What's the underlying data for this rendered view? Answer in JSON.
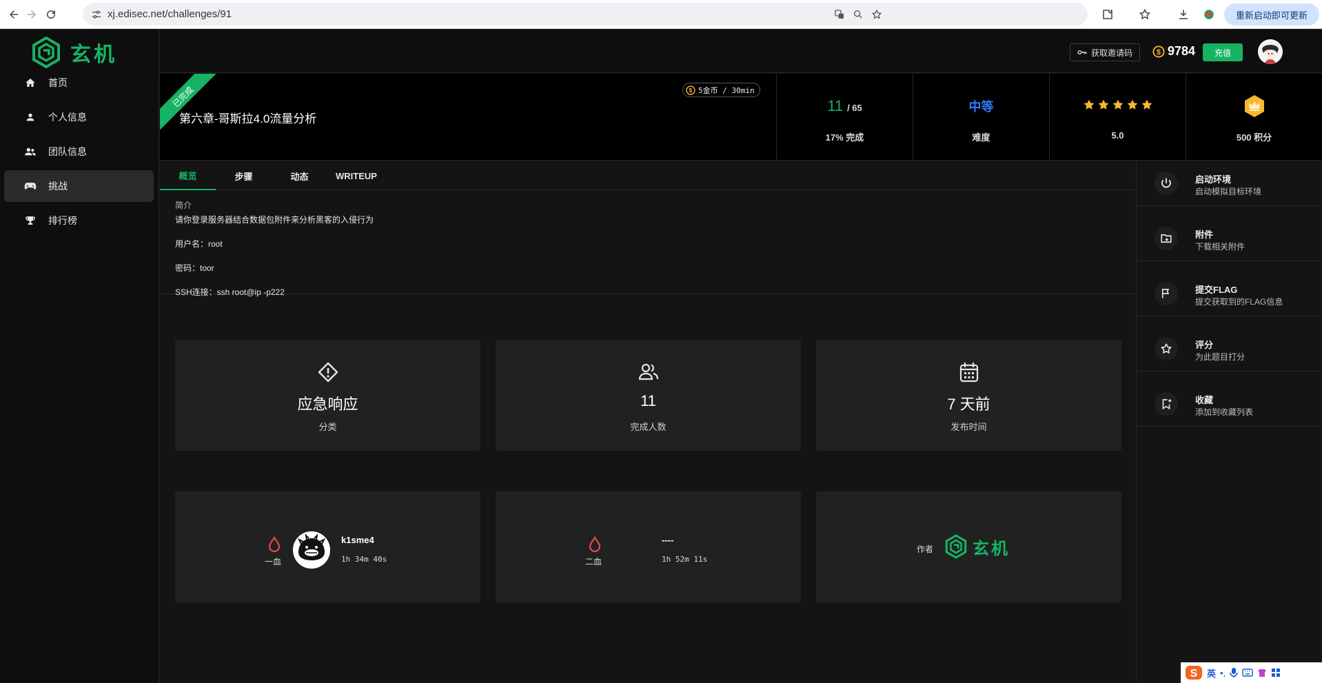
{
  "browser": {
    "url": "xj.edisec.net/challenges/91",
    "update_label": "重新启动即可更新"
  },
  "brand": {
    "name": "玄机",
    "color": "#16b364"
  },
  "sidebar": {
    "items": [
      {
        "label": "首页",
        "icon": "home-icon"
      },
      {
        "label": "个人信息",
        "icon": "person-icon"
      },
      {
        "label": "团队信息",
        "icon": "group-icon"
      },
      {
        "label": "挑战",
        "icon": "gamepad-icon",
        "active": true
      },
      {
        "label": "排行榜",
        "icon": "trophy-icon"
      }
    ]
  },
  "header": {
    "invite_label": "获取邀请码",
    "coins": "9784",
    "recharge_label": "充值"
  },
  "challenge": {
    "ribbon": "已完成",
    "title": "第六章-哥斯拉4.0流量分析",
    "cost": "5金币 / 30min",
    "completed": "11",
    "total": "/ 65",
    "completion_label": "17% 完成",
    "difficulty": "中等",
    "difficulty_label": "难度",
    "difficulty_color": "#2f7bf6",
    "rating": "5.0",
    "stars": 5,
    "points_label": "500 积分"
  },
  "tabs": [
    "概览",
    "步骤",
    "动态",
    "WRITEUP"
  ],
  "description": {
    "heading": "简介",
    "lines": [
      "请你登录服务器结合数据包附件来分析黑客的入侵行为",
      "用户名：root",
      "密码：toor",
      "SSH连接：ssh root@ip -p222"
    ]
  },
  "cards": {
    "category": {
      "value": "应急响应",
      "label": "分类"
    },
    "solvers": {
      "value": "11",
      "label": "完成人数"
    },
    "published": {
      "value": "7 天前",
      "label": "发布时间"
    },
    "first_blood": {
      "label": "一血",
      "name": "k1sme4",
      "time": "1h 34m 40s"
    },
    "second_blood": {
      "label": "二血",
      "name": "----",
      "time": "1h 52m 11s"
    },
    "author": {
      "label": "作者",
      "name": "玄机"
    }
  },
  "actions": [
    {
      "title": "启动环境",
      "subtitle": "启动模拟目标环境",
      "icon": "power-icon"
    },
    {
      "title": "附件",
      "subtitle": "下载相关附件",
      "icon": "folder-icon"
    },
    {
      "title": "提交FLAG",
      "subtitle": "提交获取到的FLAG信息",
      "icon": "flag-icon"
    },
    {
      "title": "评分",
      "subtitle": "为此题目打分",
      "icon": "star-icon"
    },
    {
      "title": "收藏",
      "subtitle": "添加到收藏列表",
      "icon": "bookmark-icon"
    }
  ],
  "ime": {
    "lang": "英"
  }
}
